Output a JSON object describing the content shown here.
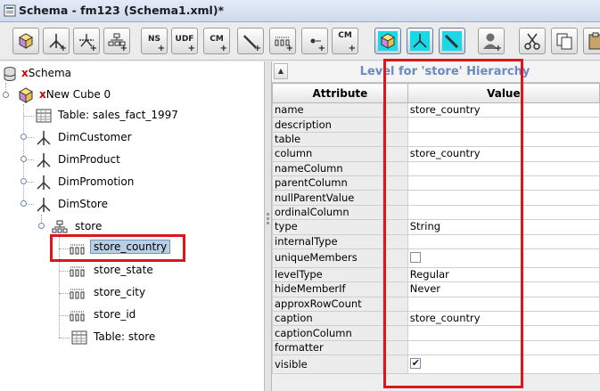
{
  "window": {
    "title": "Schema - fm123 (Schema1.xml)*"
  },
  "toolbar": {
    "buttons": [
      {
        "name": "add-cube-button",
        "icon": "cube-icon",
        "text": ""
      },
      {
        "name": "add-dimension-button",
        "icon": "dimension-icon",
        "text": ""
      },
      {
        "name": "add-dimension-usage-button",
        "icon": "dimension-usage-icon",
        "text": ""
      },
      {
        "name": "add-hierarchy-button",
        "icon": "hierarchy-icon",
        "text": ""
      },
      {
        "name": "add-named-set-button",
        "icon": "named-set-icon",
        "text": "NS"
      },
      {
        "name": "add-udf-button",
        "icon": "udf-icon",
        "text": "UDF"
      },
      {
        "name": "add-calculated-member-button",
        "icon": "calculated-member-icon",
        "text": "CM"
      },
      {
        "name": "add-measure-button",
        "icon": "measure-icon",
        "text": ""
      },
      {
        "name": "add-level-button",
        "icon": "level-icon",
        "text": ""
      },
      {
        "name": "add-property-button",
        "icon": "property-icon",
        "text": ""
      },
      {
        "name": "add-cm-property-button",
        "icon": "cm-property-icon",
        "text": "CM"
      },
      {
        "name": "add-virtual-cube-button",
        "icon": "virtual-cube-icon",
        "text": ""
      },
      {
        "name": "add-virtual-dimension-button",
        "icon": "virtual-dimension-icon",
        "text": ""
      },
      {
        "name": "add-virtual-measure-button",
        "icon": "virtual-measure-icon",
        "text": ""
      },
      {
        "name": "add-role-button",
        "icon": "role-icon",
        "text": ""
      },
      {
        "name": "cut-button",
        "icon": "scissors-icon",
        "text": ""
      },
      {
        "name": "copy-button",
        "icon": "copy-icon",
        "text": ""
      },
      {
        "name": "paste-button",
        "icon": "paste-icon",
        "text": ""
      }
    ]
  },
  "tree": {
    "root_prefix": "x",
    "root": "Schema",
    "cube_prefix": "x",
    "cube": "New Cube 0",
    "table": "Table: sales_fact_1997",
    "dimensions": [
      "DimCustomer",
      "DimProduct",
      "DimPromotion",
      "DimStore"
    ],
    "hierarchy": "store",
    "levels": [
      "store_country",
      "store_state",
      "store_city",
      "store_id"
    ],
    "selected_level": "store_country",
    "hier_table": "Table: store"
  },
  "properties": {
    "title": "Level for 'store' Hierarchy",
    "col_attribute": "Attribute",
    "col_value": "Value",
    "rows": [
      {
        "attr": "name",
        "value": "store_country"
      },
      {
        "attr": "description",
        "value": ""
      },
      {
        "attr": "table",
        "value": ""
      },
      {
        "attr": "column",
        "value": "store_country"
      },
      {
        "attr": "nameColumn",
        "value": ""
      },
      {
        "attr": "parentColumn",
        "value": ""
      },
      {
        "attr": "nullParentValue",
        "value": ""
      },
      {
        "attr": "ordinalColumn",
        "value": ""
      },
      {
        "attr": "type",
        "value": "String"
      },
      {
        "attr": "internalType",
        "value": ""
      },
      {
        "attr": "uniqueMembers",
        "value": ""
      },
      {
        "attr": "levelType",
        "value": "Regular"
      },
      {
        "attr": "hideMemberIf",
        "value": "Never"
      },
      {
        "attr": "approxRowCount",
        "value": ""
      },
      {
        "attr": "caption",
        "value": "store_country"
      },
      {
        "attr": "captionColumn",
        "value": ""
      },
      {
        "attr": "formatter",
        "value": ""
      },
      {
        "attr": "visible",
        "value": ""
      }
    ],
    "uniqueMembers_checked": false,
    "visible_checked": true
  },
  "colors": {
    "highlight_red": "#e0151b",
    "title_blue": "#6a8ac0",
    "selection": "#b8cfe5"
  }
}
